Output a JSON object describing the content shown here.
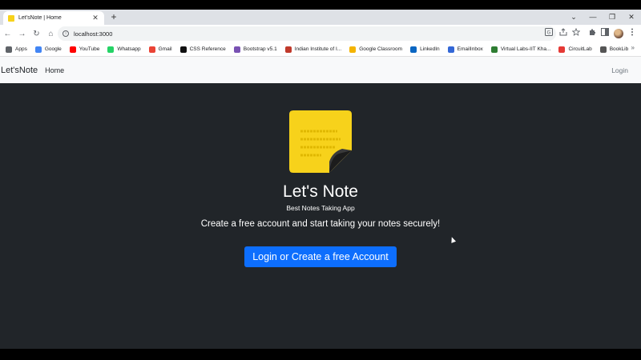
{
  "browser": {
    "tab": {
      "title": "Let'sNote | Home",
      "close": "✕"
    },
    "new_tab": "+",
    "window_controls": {
      "minimize": "—",
      "restore": "❐",
      "close": "✕",
      "tab_search": "⌄"
    },
    "nav": {
      "back": "←",
      "forward": "→",
      "reload": "↻",
      "home": "⌂"
    },
    "address": "localhost:3000",
    "toolbar_icons": [
      "translate-icon",
      "share-icon",
      "star-icon",
      "extensions-icon",
      "side-panel-icon",
      "menu-icon"
    ],
    "bookmarks": [
      {
        "label": "Apps",
        "color": "#5f6368"
      },
      {
        "label": "Google",
        "color": "#4285f4"
      },
      {
        "label": "YouTube",
        "color": "#ff0000"
      },
      {
        "label": "Whatsapp",
        "color": "#25d366"
      },
      {
        "label": "Gmail",
        "color": "#ea4335"
      },
      {
        "label": "CSS Reference",
        "color": "#111111"
      },
      {
        "label": "Bootstrap v5.1",
        "color": "#7952b3"
      },
      {
        "label": "Indian Institute of I...",
        "color": "#c0392b"
      },
      {
        "label": "Google Classroom",
        "color": "#f4b400"
      },
      {
        "label": "LinkedIn",
        "color": "#0a66c2"
      },
      {
        "label": "EmailInbox",
        "color": "#3367d6"
      },
      {
        "label": "Virtual Labs-IIT Kha...",
        "color": "#2e7d32"
      },
      {
        "label": "CircuitLab",
        "color": "#e53935"
      },
      {
        "label": "BookLib",
        "color": "#555555"
      }
    ],
    "bookmarks_more": "»"
  },
  "site": {
    "brand": "Let'sNote",
    "nav_home": "Home",
    "login": "Login",
    "title": "Let's Note",
    "subtitle": "Best Notes Taking App",
    "lead": "Create a free account and start taking your notes securely!",
    "cta": "Login or Create a free Account",
    "colors": {
      "page_bg": "#212529",
      "navbar_bg": "#f8f9fa",
      "primary": "#0d6efd",
      "note": "#f7d21b"
    }
  }
}
